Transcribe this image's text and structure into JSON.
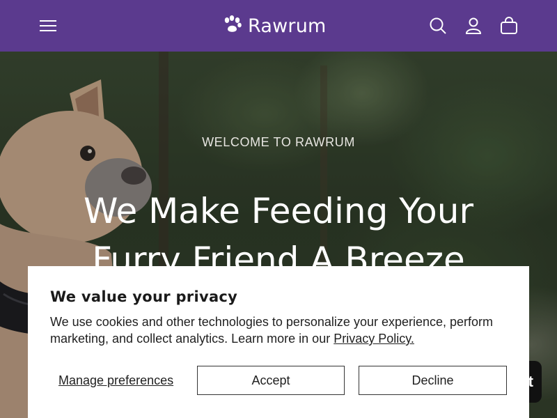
{
  "header": {
    "brand": "Rawrum",
    "menu_icon": "hamburger-menu-icon",
    "search_icon": "search-icon",
    "account_icon": "user-icon",
    "cart_icon": "shopping-bag-icon",
    "background_color": "#5b3a8e"
  },
  "hero": {
    "kicker": "WELCOME TO RAWRUM",
    "title": "We Make Feeding Your Furry Friend A Breeze",
    "chat_label": "t"
  },
  "cookie_banner": {
    "title": "We value your privacy",
    "text": "We use cookies and other technologies to personalize your experience, perform marketing, and collect analytics. Learn more in our ",
    "link_label": "Privacy Policy.",
    "manage_label": "Manage preferences",
    "accept_label": "Accept",
    "decline_label": "Decline"
  }
}
